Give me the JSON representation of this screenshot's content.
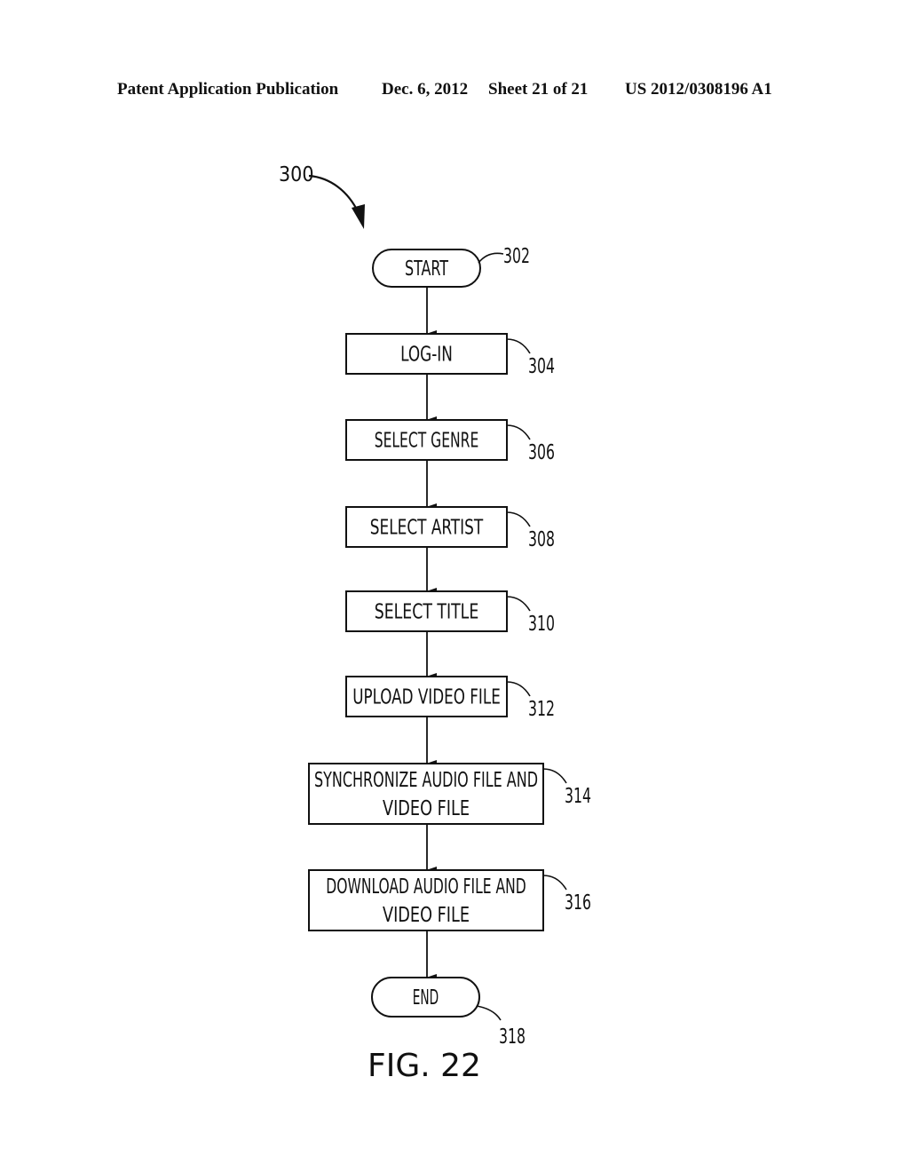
{
  "header": {
    "publication": "Patent Application Publication",
    "date": "Dec. 6, 2012",
    "sheet": "Sheet 21 of 21",
    "number": "US 2012/0308196 A1"
  },
  "figure": {
    "caption": "FIG. 22",
    "ref": "300"
  },
  "nodes": [
    {
      "id": "start",
      "shape": "terminal",
      "lines": [
        "START"
      ],
      "ref": "302"
    },
    {
      "id": "login",
      "shape": "process",
      "lines": [
        "LOG-IN"
      ],
      "ref": "304"
    },
    {
      "id": "select-genre",
      "shape": "process",
      "lines": [
        "SELECT GENRE"
      ],
      "ref": "306"
    },
    {
      "id": "select-artist",
      "shape": "process",
      "lines": [
        "SELECT ARTIST"
      ],
      "ref": "308"
    },
    {
      "id": "select-title",
      "shape": "process",
      "lines": [
        "SELECT TITLE"
      ],
      "ref": "310"
    },
    {
      "id": "upload-video",
      "shape": "process",
      "lines": [
        "UPLOAD VIDEO FILE"
      ],
      "ref": "312"
    },
    {
      "id": "synchronize",
      "shape": "process",
      "lines": [
        "SYNCHRONIZE AUDIO FILE AND",
        "VIDEO FILE"
      ],
      "ref": "314"
    },
    {
      "id": "download",
      "shape": "process",
      "lines": [
        "DOWNLOAD AUDIO FILE AND",
        "VIDEO FILE"
      ],
      "ref": "316"
    },
    {
      "id": "end",
      "shape": "terminal",
      "lines": [
        "END"
      ],
      "ref": "318"
    }
  ],
  "edges": [
    [
      "start",
      "login"
    ],
    [
      "login",
      "select-genre"
    ],
    [
      "select-genre",
      "select-artist"
    ],
    [
      "select-artist",
      "select-title"
    ],
    [
      "select-title",
      "upload-video"
    ],
    [
      "upload-video",
      "synchronize"
    ],
    [
      "synchronize",
      "download"
    ],
    [
      "download",
      "end"
    ]
  ]
}
